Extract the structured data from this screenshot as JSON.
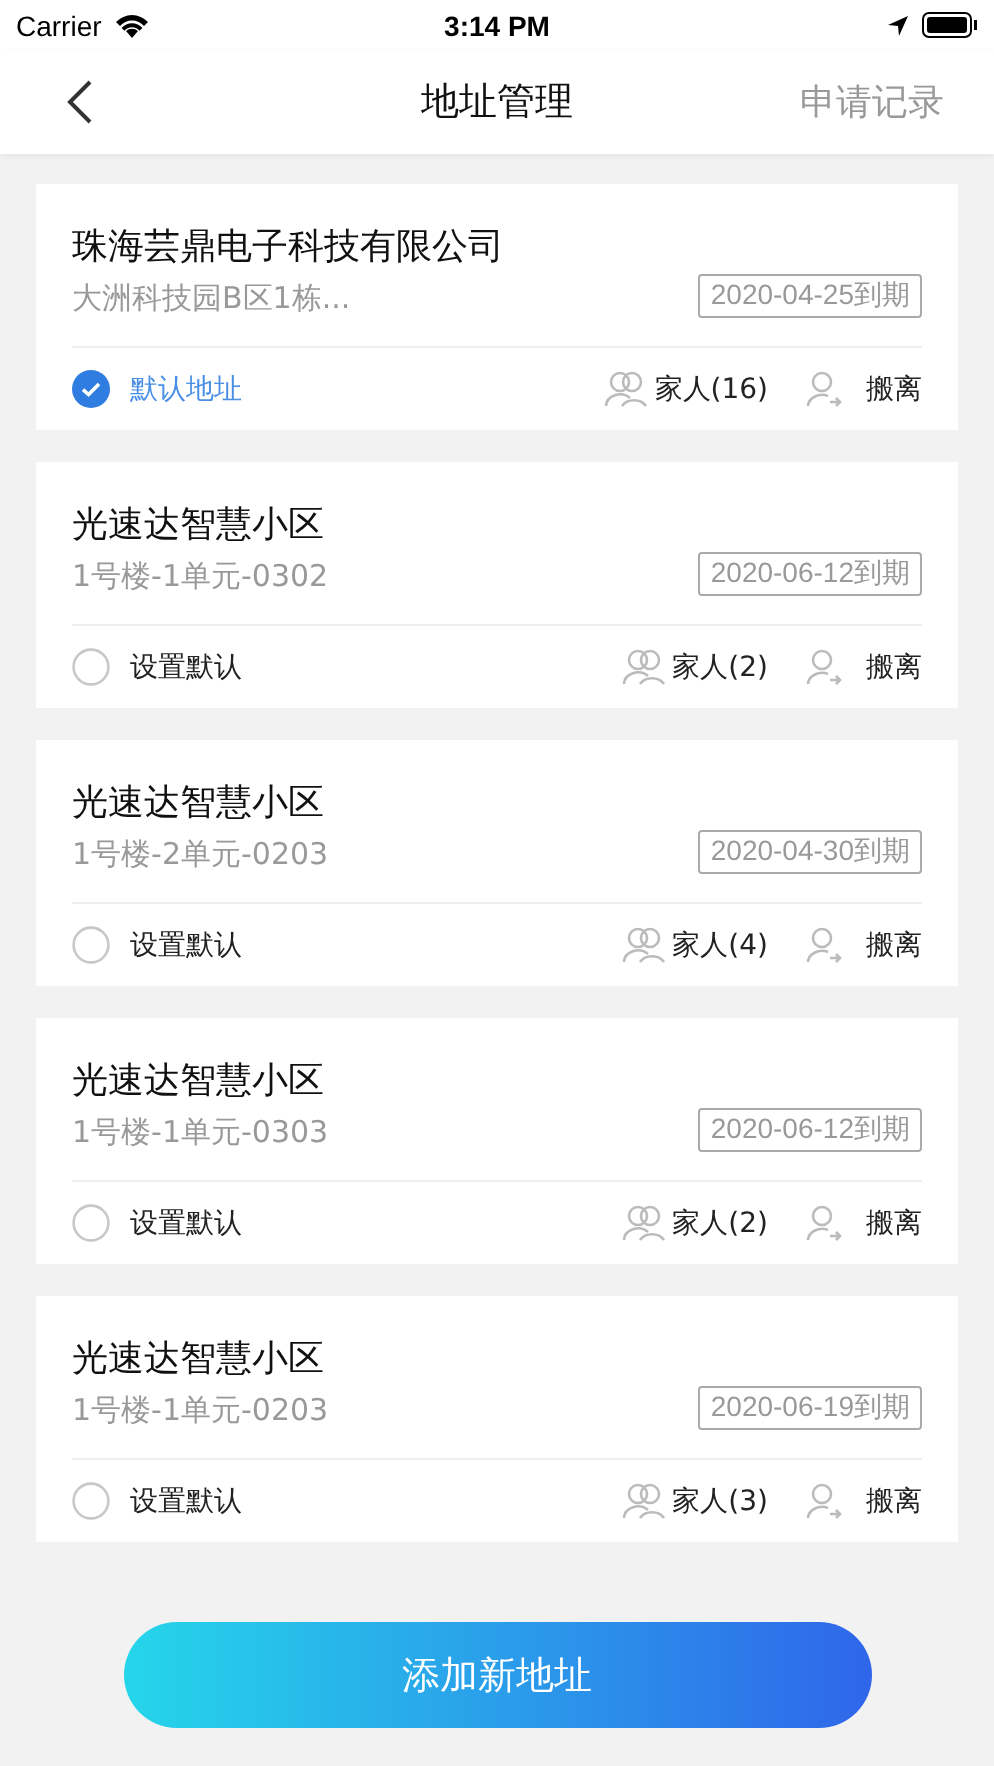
{
  "status_bar": {
    "carrier": "Carrier",
    "time": "3:14 PM"
  },
  "nav": {
    "title": "地址管理",
    "action": "申请记录"
  },
  "addresses": [
    {
      "name": "珠海芸鼎电子科技有限公司",
      "detail": "大洲科技园B区1栋...",
      "expiry": "2020-04-25到期",
      "default_label": "默认地址",
      "selected": true,
      "family": "家人(16)",
      "move_out": "搬离"
    },
    {
      "name": "光速达智慧小区",
      "detail": "1号楼-1单元-0302",
      "expiry": "2020-06-12到期",
      "default_label": "设置默认",
      "selected": false,
      "family": "家人(2)",
      "move_out": "搬离"
    },
    {
      "name": "光速达智慧小区",
      "detail": "1号楼-2单元-0203",
      "expiry": "2020-04-30到期",
      "default_label": "设置默认",
      "selected": false,
      "family": "家人(4)",
      "move_out": "搬离"
    },
    {
      "name": "光速达智慧小区",
      "detail": "1号楼-1单元-0303",
      "expiry": "2020-06-12到期",
      "default_label": "设置默认",
      "selected": false,
      "family": "家人(2)",
      "move_out": "搬离"
    },
    {
      "name": "光速达智慧小区",
      "detail": "1号楼-1单元-0203",
      "expiry": "2020-06-19到期",
      "default_label": "设置默认",
      "selected": false,
      "family": "家人(3)",
      "move_out": "搬离"
    }
  ],
  "add_button": "添加新地址"
}
